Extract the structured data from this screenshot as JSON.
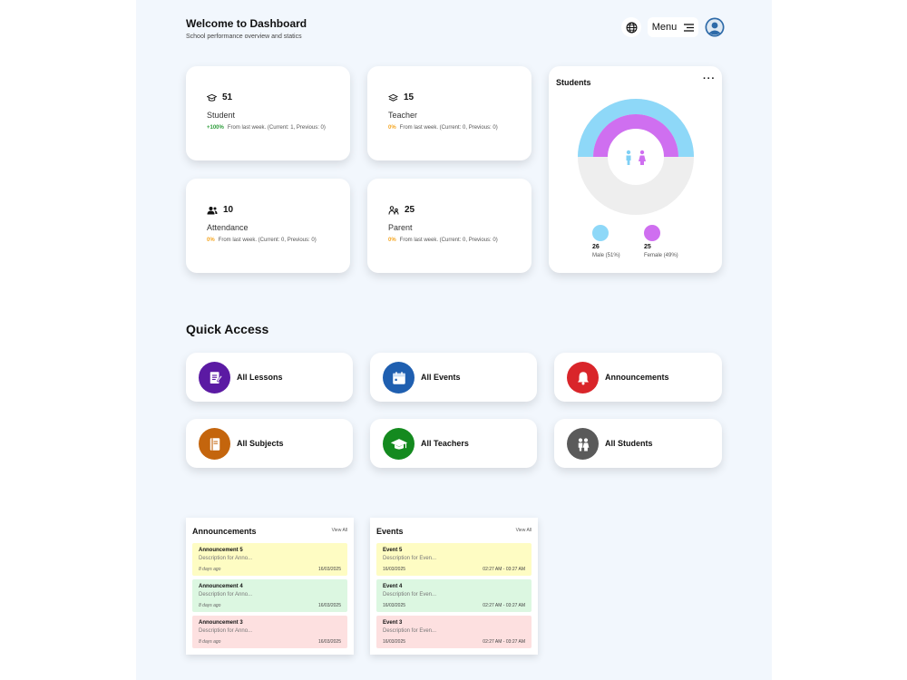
{
  "header": {
    "title": "Welcome to Dashboard",
    "subtitle": "School performance overview and statics",
    "menu_label": "Menu"
  },
  "stats": [
    {
      "value": "51",
      "label": "Student",
      "change": "+100%",
      "change_text": "From last week. (Current: 1, Previous: 0)",
      "icon": "graduation-cap-icon"
    },
    {
      "value": "15",
      "label": "Teacher",
      "change": "0%",
      "change_text": "From last week. (Current: 0, Previous: 0)",
      "icon": "layers-icon"
    },
    {
      "value": "10",
      "label": "Attendance",
      "change": "0%",
      "change_text": "From last week. (Current: 0, Previous: 0)",
      "icon": "users-icon"
    },
    {
      "value": "25",
      "label": "Parent",
      "change": "0%",
      "change_text": "From last week. (Current: 0, Previous: 0)",
      "icon": "parent-icon"
    }
  ],
  "students_card": {
    "title": "Students",
    "male_count": "26",
    "male_label": "Male (51%)",
    "female_count": "25",
    "female_label": "Female (49%)",
    "male_color": "#8ed8f8",
    "female_color": "#cf6ff0"
  },
  "quick_access": {
    "title": "Quick Access",
    "items": [
      {
        "label": "All Lessons",
        "color": "#5b1aa3",
        "icon": "notebook-icon"
      },
      {
        "label": "All Events",
        "color": "#1f5fb0",
        "icon": "calendar-icon"
      },
      {
        "label": "Announcements",
        "color": "#d9252a",
        "icon": "bell-icon"
      },
      {
        "label": "All Subjects",
        "color": "#c4650d",
        "icon": "book-icon"
      },
      {
        "label": "All Teachers",
        "color": "#148a1f",
        "icon": "mortarboard-icon"
      },
      {
        "label": "All Students",
        "color": "#5a5a5a",
        "icon": "students-icon"
      }
    ]
  },
  "announcements": {
    "title": "Announcements",
    "view_all": "View All",
    "items": [
      {
        "title": "Announcement 5",
        "desc": "Description for Anno...",
        "ago": "8 days ago",
        "date": "16/03/2025"
      },
      {
        "title": "Announcement 4",
        "desc": "Description for Anno...",
        "ago": "8 days ago",
        "date": "16/03/2025"
      },
      {
        "title": "Announcement 3",
        "desc": "Description for Anno...",
        "ago": "8 days ago",
        "date": "16/03/2025"
      }
    ]
  },
  "events": {
    "title": "Events",
    "view_all": "View All",
    "items": [
      {
        "title": "Event 5",
        "desc": "Description for Even...",
        "date": "16/03/2025",
        "time": "02:27 AM - 03:27 AM"
      },
      {
        "title": "Event 4",
        "desc": "Description for Even...",
        "date": "16/03/2025",
        "time": "02:27 AM - 03:27 AM"
      },
      {
        "title": "Event 3",
        "desc": "Description for Even...",
        "date": "16/03/2025",
        "time": "02:27 AM - 03:27 AM"
      }
    ]
  }
}
